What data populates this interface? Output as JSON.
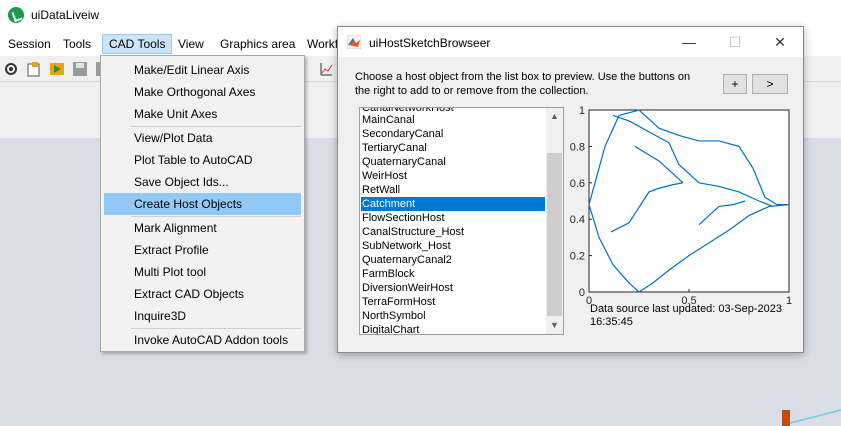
{
  "app": {
    "title": "uiDataLiveiw"
  },
  "menubar": {
    "items": [
      "Session",
      "Tools",
      "CAD Tools",
      "View",
      "Graphics area",
      "Workf"
    ]
  },
  "dropdown": {
    "items": [
      "Make/Edit Linear Axis",
      "Make Orthogonal Axes",
      "Make Unit Axes",
      "View/Plot Data",
      "Plot Table to AutoCAD",
      "Save Object Ids...",
      "Create Host Objects",
      "Mark Alignment",
      "Extract Profile",
      "Multi Plot tool",
      "Extract CAD Objects",
      "Inquire3D",
      "Invoke AutoCAD Addon tools"
    ],
    "highlighted": "Create Host Objects"
  },
  "dialog": {
    "title": "uiHostSketchBrowseer",
    "minimize": "—",
    "maximize": "☐",
    "close": "✕",
    "instructions": "Choose a host object from the list box to preview. Use the buttons on the right to add to or remove from the collection.",
    "add_label": "+",
    "next_label": ">",
    "list_items": [
      "CanalNetworkHost",
      "MainCanal",
      "SecondaryCanal",
      "TertiaryCanal",
      "QuaternaryCanal",
      "WeirHost",
      "RetWall",
      "Catchment",
      "FlowSectionHost",
      "CanalStructure_Host",
      "SubNetwork_Host",
      "QuaternaryCanal2",
      "FarmBlock",
      "DiversionWeirHost",
      "TerraFormHost",
      "NorthSymbol",
      "DigitalChart"
    ],
    "selected_item": "Catchment",
    "datasource": "Data source last updated: 03-Sep-2023 16:35:45"
  },
  "chart_data": {
    "type": "line",
    "xlim": [
      0,
      1
    ],
    "ylim": [
      0,
      1
    ],
    "yticks": [
      "0",
      "0.2",
      "0.4",
      "0.6",
      "0.8",
      "1"
    ],
    "xticks": [
      "0",
      "0.5",
      "1"
    ],
    "line_color": "#0072bd",
    "series": [
      {
        "x": [
          0.0,
          0.03,
          0.08,
          0.15,
          0.25,
          0.35,
          0.45,
          0.55,
          0.65,
          0.75,
          0.82,
          0.88,
          0.94,
          1.0
        ],
        "y": [
          0.48,
          0.6,
          0.8,
          0.97,
          1.0,
          0.9,
          0.86,
          0.83,
          0.83,
          0.8,
          0.68,
          0.52,
          0.48,
          0.48
        ]
      },
      {
        "x": [
          0.0,
          0.05,
          0.12,
          0.2,
          0.25,
          0.32,
          0.4,
          0.5,
          0.6,
          0.7,
          0.8,
          0.9,
          1.0
        ],
        "y": [
          0.48,
          0.3,
          0.15,
          0.05,
          0.0,
          0.05,
          0.12,
          0.2,
          0.27,
          0.34,
          0.42,
          0.47,
          0.48
        ]
      },
      {
        "x": [
          0.12,
          0.2,
          0.3,
          0.4,
          0.45,
          0.55,
          0.65,
          0.75,
          0.85,
          0.92
        ],
        "y": [
          0.97,
          0.94,
          0.88,
          0.82,
          0.7,
          0.6,
          0.58,
          0.55,
          0.5,
          0.47
        ]
      },
      {
        "x": [
          0.23,
          0.35,
          0.45,
          0.47
        ],
        "y": [
          0.8,
          0.72,
          0.62,
          0.6
        ]
      },
      {
        "x": [
          0.11,
          0.2,
          0.3,
          0.35,
          0.42,
          0.47
        ],
        "y": [
          0.33,
          0.38,
          0.55,
          0.57,
          0.59,
          0.6
        ]
      },
      {
        "x": [
          0.55,
          0.6,
          0.65,
          0.72,
          0.78
        ],
        "y": [
          0.37,
          0.42,
          0.47,
          0.48,
          0.5
        ]
      }
    ]
  }
}
